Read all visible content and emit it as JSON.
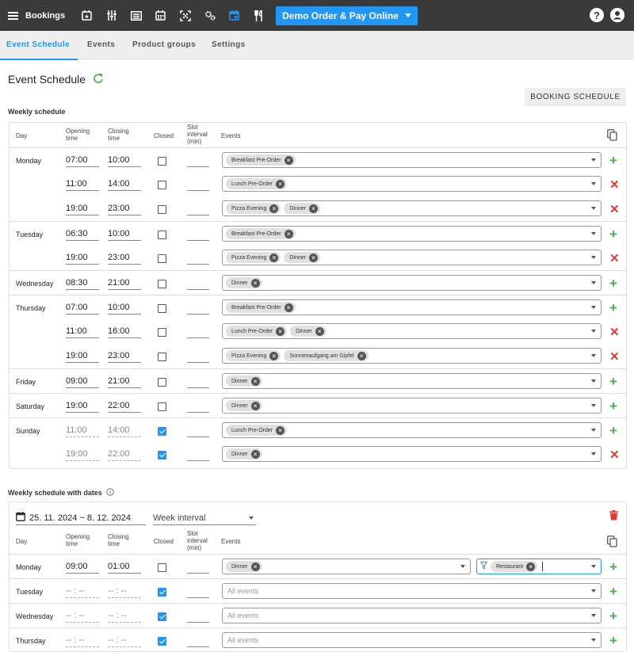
{
  "app": {
    "title": "Bookings",
    "venue": "Demo Order & Pay Online",
    "help": "?"
  },
  "toolbar_icons": [
    "calendar-star-icon",
    "sliders-icon",
    "list-icon",
    "calendar-grid-icon",
    "qr-code-icon",
    "cogs-icon",
    "calendar-active-icon",
    "cutlery-icon"
  ],
  "tabs": [
    "Event Schedule",
    "Events",
    "Product groups",
    "Settings"
  ],
  "page": {
    "title": "Event Schedule",
    "booking_schedule_button": "BOOKING SCHEDULE"
  },
  "weekly": {
    "title": "Weekly schedule",
    "headers": {
      "day": "Day",
      "opening": "Opening time",
      "closing": "Closing time",
      "closed": "Closed",
      "slot": "Slot interval (min)",
      "events": "Events"
    },
    "rows": [
      {
        "day": "Monday",
        "open": "07:00",
        "close": "10:00",
        "closed": false,
        "events": [
          "Breakfast Pre-Order"
        ],
        "action": "add"
      },
      {
        "day": "",
        "open": "11:00",
        "close": "14:00",
        "closed": false,
        "events": [
          "Lunch Pre-Order"
        ],
        "action": "remove"
      },
      {
        "day": "",
        "open": "19:00",
        "close": "23:00",
        "closed": false,
        "events": [
          "Pizza Evening",
          "Dinner"
        ],
        "action": "remove"
      },
      {
        "day": "Tuesday",
        "open": "06:30",
        "close": "10:00",
        "closed": false,
        "events": [
          "Breakfast Pre-Order"
        ],
        "action": "add"
      },
      {
        "day": "",
        "open": "19:00",
        "close": "23:00",
        "closed": false,
        "events": [
          "Pizza Evening",
          "Dinner"
        ],
        "action": "remove"
      },
      {
        "day": "Wednesday",
        "open": "08:30",
        "close": "21:00",
        "closed": false,
        "events": [
          "Dinner"
        ],
        "action": "add"
      },
      {
        "day": "Thursday",
        "open": "07:00",
        "close": "10:00",
        "closed": false,
        "events": [
          "Breakfast Pre-Order"
        ],
        "action": "add"
      },
      {
        "day": "",
        "open": "11:00",
        "close": "16:00",
        "closed": false,
        "events": [
          "Lunch Pre-Order",
          "Dinner"
        ],
        "action": "remove"
      },
      {
        "day": "",
        "open": "19:00",
        "close": "23:00",
        "closed": false,
        "events": [
          "Pizza Evening",
          "Sonnenaufgang am Gipfel"
        ],
        "action": "remove"
      },
      {
        "day": "Friday",
        "open": "09:00",
        "close": "21:00",
        "closed": false,
        "events": [
          "Dinner"
        ],
        "action": "add"
      },
      {
        "day": "Saturday",
        "open": "19:00",
        "close": "22:00",
        "closed": false,
        "events": [
          "Dinner"
        ],
        "action": "add"
      },
      {
        "day": "Sunday",
        "open": "11:00",
        "close": "14:00",
        "closed": true,
        "events": [
          "Lunch Pre-Order"
        ],
        "action": "add"
      },
      {
        "day": "",
        "open": "19:00",
        "close": "22:00",
        "closed": true,
        "events": [
          "Dinner"
        ],
        "action": "remove"
      }
    ]
  },
  "dated": {
    "title": "Weekly schedule with dates",
    "range": "25. 11. 2024 ~ 8. 12. 2024",
    "interval": "Week interval",
    "headers": {
      "day": "Day",
      "opening": "Opening time",
      "closing": "Closing time",
      "closed": "Closed",
      "slot": "Slot interval (min)",
      "events": "Events"
    },
    "rows": [
      {
        "day": "Monday",
        "open": "09:00",
        "close": "01:00",
        "closed": false,
        "events": [
          "Dinner"
        ],
        "filter": [
          "Restaurant"
        ],
        "action": "add"
      },
      {
        "day": "Tuesday",
        "open": "-- : --",
        "close": "-- : --",
        "closed": true,
        "events": [],
        "placeholder": "All events",
        "action": "add"
      },
      {
        "day": "Wednesday",
        "open": "-- : --",
        "close": "-- : --",
        "closed": true,
        "events": [],
        "placeholder": "All events",
        "action": "add"
      },
      {
        "day": "Thursday",
        "open": "-- : --",
        "close": "-- : --",
        "closed": true,
        "events": [],
        "placeholder": "All events",
        "action": "add"
      }
    ]
  }
}
